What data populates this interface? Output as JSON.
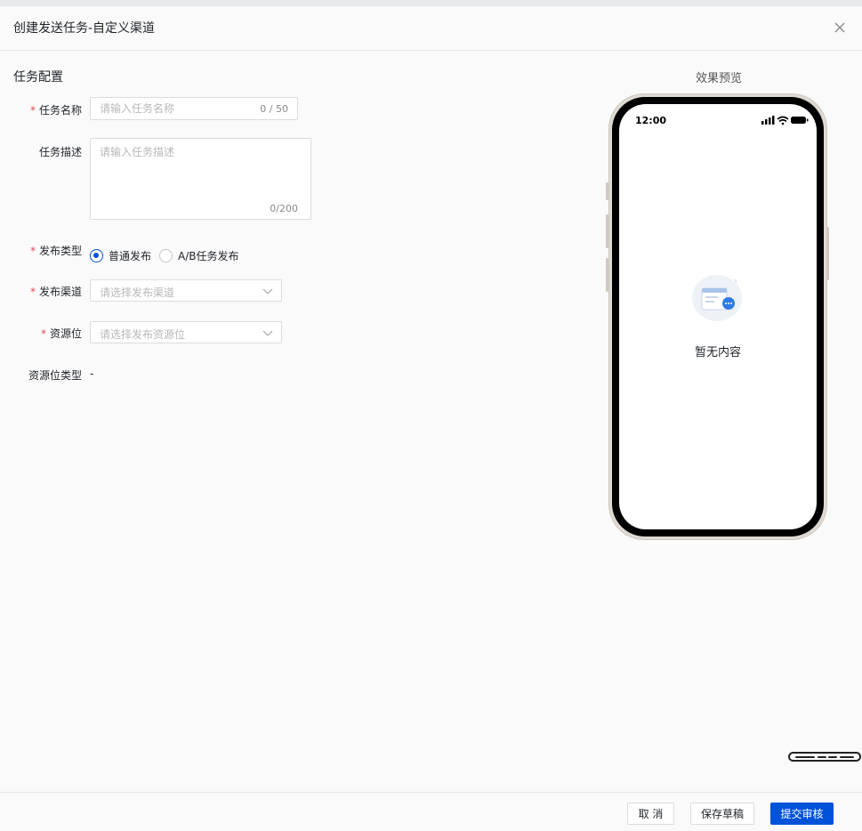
{
  "dialog": {
    "title": "创建发送任务-自定义渠道",
    "close_icon": "close-icon"
  },
  "form": {
    "section_title": "任务配置",
    "task_name": {
      "label": "任务名称",
      "required": "*",
      "placeholder": "请输入任务名称",
      "value": "",
      "counter": "0 / 50"
    },
    "task_desc": {
      "label": "任务描述",
      "placeholder": "请输入任务描述",
      "value": "",
      "counter": "0/200"
    },
    "publish_type": {
      "label": "发布类型",
      "required": "*",
      "options": [
        "普通发布",
        "A/B任务发布"
      ],
      "selected": "普通发布"
    },
    "publish_channel": {
      "label": "发布渠道",
      "required": "*",
      "placeholder": "请选择发布渠道"
    },
    "resource_slot": {
      "label": "资源位",
      "required": "*",
      "placeholder": "请选择发布资源位"
    },
    "resource_type": {
      "label": "资源位类型",
      "value": "-"
    }
  },
  "preview": {
    "title": "效果预览",
    "status_time": "12:00",
    "empty_text": "暂无内容"
  },
  "footer": {
    "cancel_label": "取 消",
    "save_draft_label": "保存草稿",
    "submit_label": "提交审核"
  },
  "colors": {
    "primary": "#0052d9",
    "required": "#e34d59",
    "border": "#dcdcdc"
  }
}
